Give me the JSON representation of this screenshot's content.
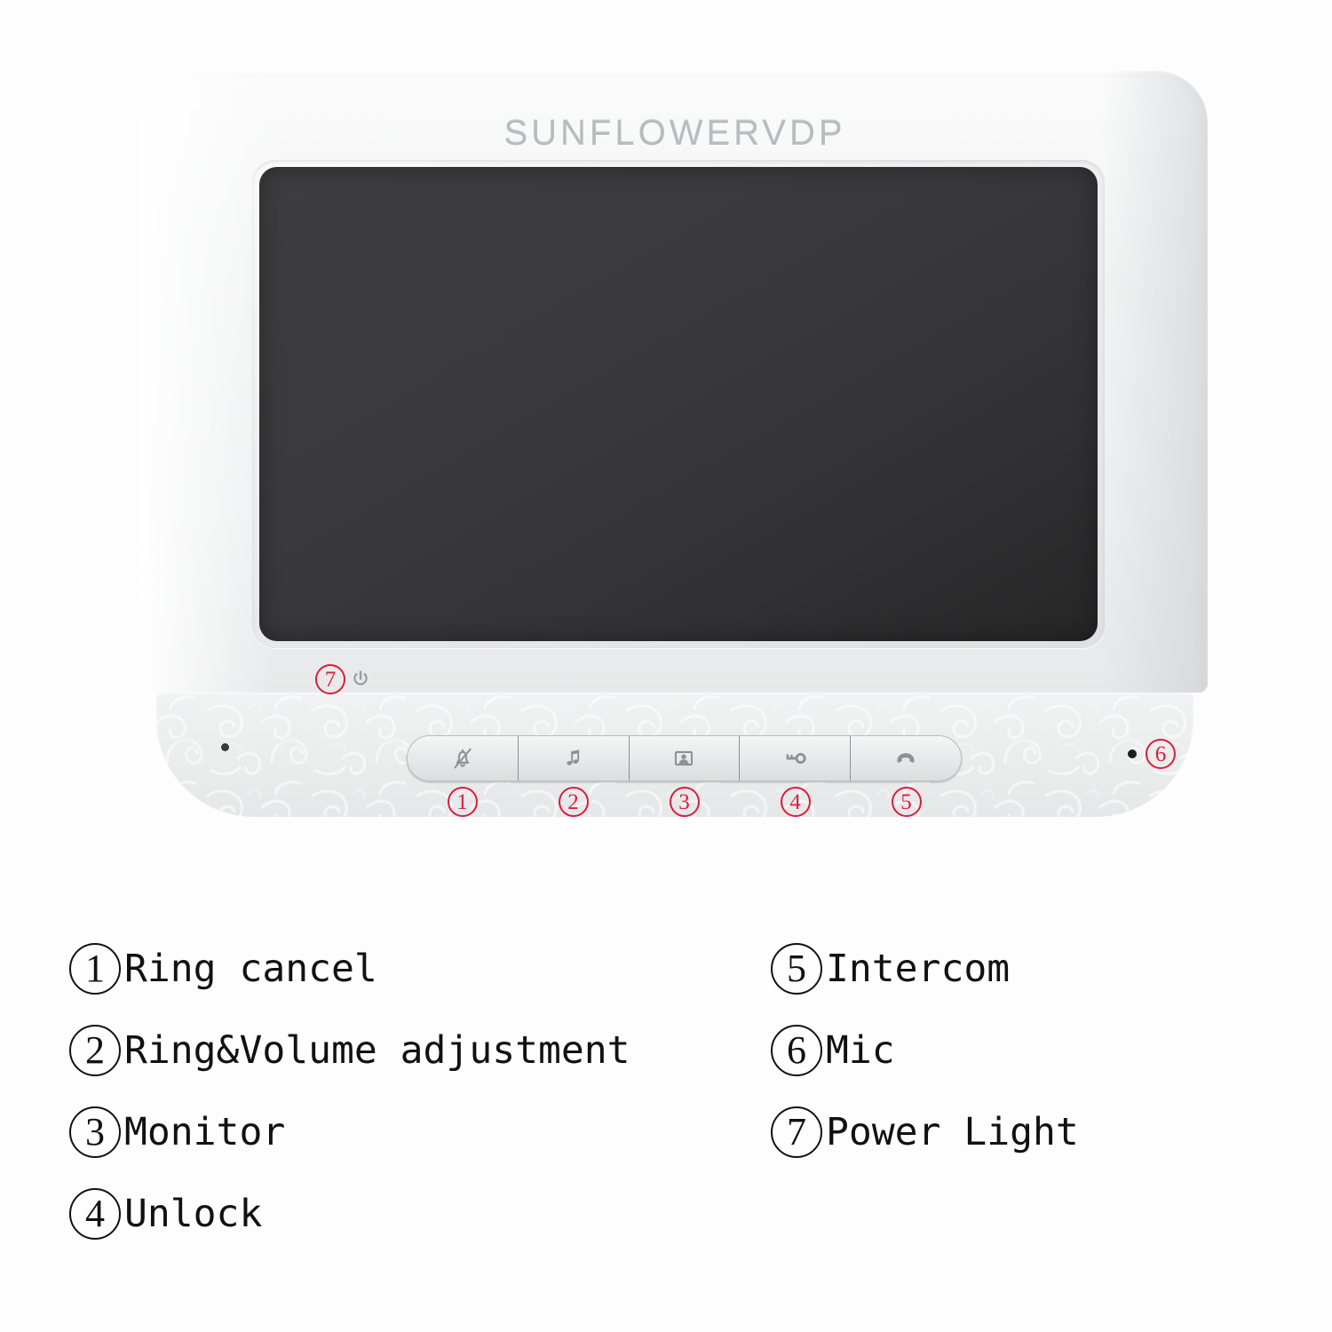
{
  "device": {
    "brand": "SUNFLOWERVDP",
    "screen_color": "#3a3a3c",
    "body_color": "#f1f2f3",
    "marker_color": "#d81e3c",
    "power_marker": "7",
    "power_icon": "power-symbol-icon",
    "mic_marker": "6",
    "speaker_hole": "speaker-hole",
    "mic_hole": "mic-hole",
    "buttons": [
      {
        "marker": "1",
        "icon": "bell-muted-icon",
        "name": "ring-cancel-button"
      },
      {
        "marker": "2",
        "icon": "music-note-icon",
        "name": "ring-volume-button"
      },
      {
        "marker": "3",
        "icon": "monitor-person-icon",
        "name": "monitor-button"
      },
      {
        "marker": "4",
        "icon": "key-icon",
        "name": "unlock-button"
      },
      {
        "marker": "5",
        "icon": "phone-handset-icon",
        "name": "intercom-button"
      }
    ]
  },
  "legend": {
    "left": [
      {
        "num": "①",
        "label": "Ring cancel"
      },
      {
        "num": "②",
        "label": "Ring&Volume adjustment"
      },
      {
        "num": "③",
        "label": "Monitor"
      },
      {
        "num": "④",
        "label": "Unlock"
      }
    ],
    "right": [
      {
        "num": "⑤",
        "label": "Intercom"
      },
      {
        "num": "⑥",
        "label": "Mic"
      },
      {
        "num": "⑦",
        "label": "Power Light"
      }
    ],
    "left_nums": [
      "1",
      "2",
      "3",
      "4"
    ],
    "right_nums": [
      "5",
      "6",
      "7"
    ]
  }
}
